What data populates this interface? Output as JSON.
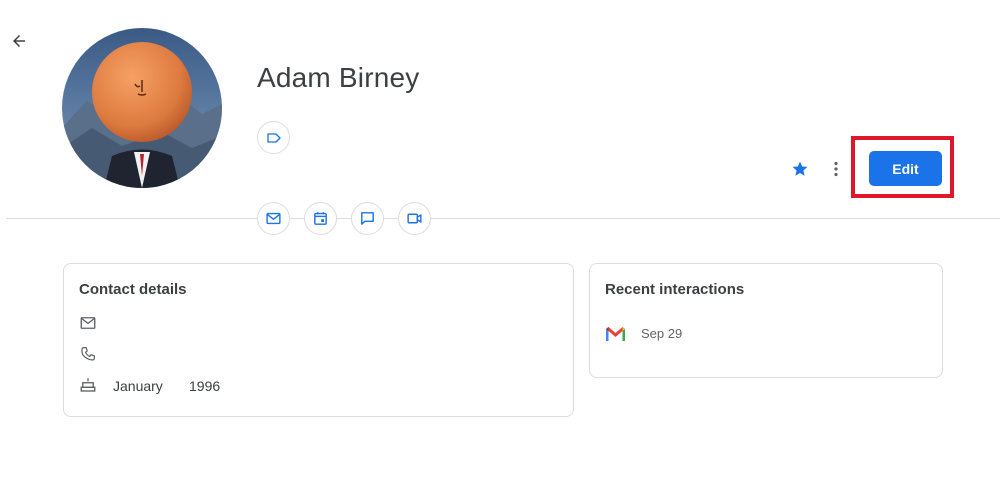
{
  "contact": {
    "name": "Adam Birney"
  },
  "header": {
    "edit_label": "Edit"
  },
  "icons": {
    "back": "arrow-left-icon",
    "label": "label-icon",
    "email": "email-icon",
    "calendar": "calendar-icon",
    "chat": "chat-icon",
    "video": "video-icon",
    "star": "star-icon",
    "more": "more-vert-icon",
    "phone": "phone-icon",
    "birthday": "cake-icon",
    "gmail": "gmail-icon"
  },
  "contact_details": {
    "title": "Contact details",
    "birthday_month": "January",
    "birthday_year": "1996"
  },
  "recent_interactions": {
    "title": "Recent interactions",
    "items": [
      {
        "date": "Sep 29"
      }
    ]
  },
  "colors": {
    "accent": "#1a73e8",
    "highlight": "#e0162b",
    "icon": "#5f6368"
  }
}
